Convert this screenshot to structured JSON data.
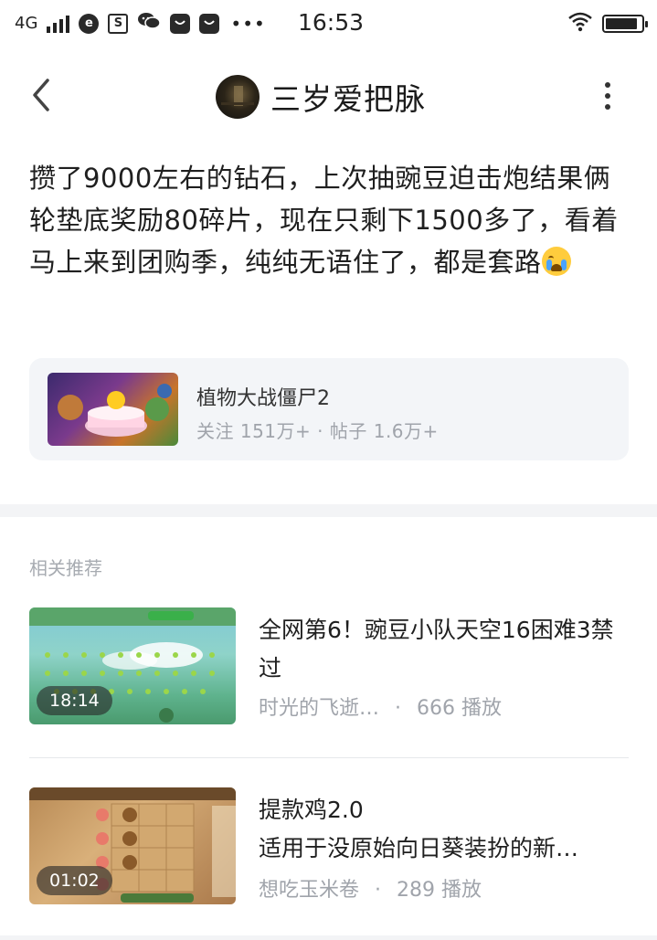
{
  "status_bar": {
    "network": "4G",
    "time": "16:53",
    "app_icons": [
      "browser-icon",
      "s-app-icon",
      "wechat-icon",
      "shopping-bag-icon",
      "shopping-bag-icon"
    ],
    "more": "•••",
    "battery_level": 0.9
  },
  "nav": {
    "title": "三岁爱把脉",
    "back_icon": "chevron-left-icon",
    "more_icon": "more-vertical-icon"
  },
  "post": {
    "text": "攒了9000左右的钻石，上次抽豌豆迫击炮结果俩轮垫底奖励80碎片，现在只剩下1500多了，看着马上来到团购季，纯纯无语住了，都是套路",
    "emoji": "crying-face-emoji"
  },
  "game_card": {
    "name": "植物大战僵尸2",
    "meta": "关注 151万+  ·  帖子 1.6万+"
  },
  "recommend": {
    "section_title": "相关推荐",
    "items": [
      {
        "title": "全网第6！豌豆小队天空16困难3禁过",
        "duration": "18:14",
        "author": "时光的飞逝…",
        "plays": "666 播放"
      },
      {
        "title": "提款鸡2.0\n适用于没原始向日葵装扮的新…",
        "duration": "01:02",
        "author": "想吃玉米卷",
        "plays": "289 播放"
      }
    ]
  },
  "colors": {
    "text_primary": "#1f1f1f",
    "text_secondary": "#a0a4ab",
    "card_bg": "#f3f5f8",
    "divider": "#f3f4f6"
  }
}
